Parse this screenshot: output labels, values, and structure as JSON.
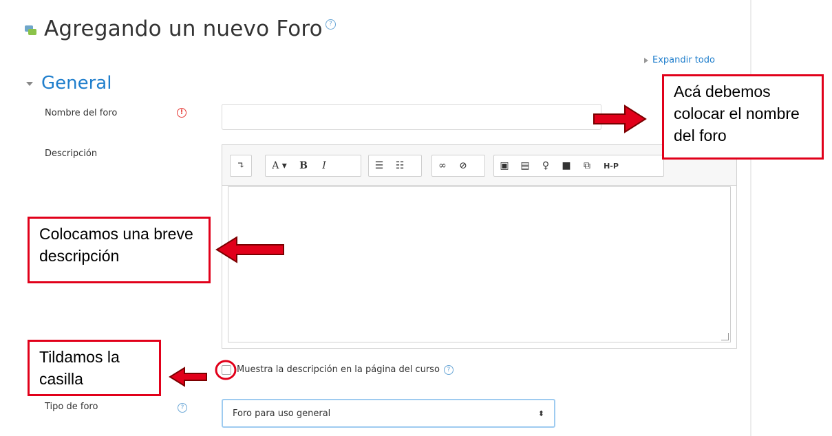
{
  "page": {
    "title": "Agregando un nuevo Foro",
    "expand_all": "Expandir todo"
  },
  "section": {
    "title": "General"
  },
  "form": {
    "name_label": "Nombre del foro",
    "name_value": "",
    "description_label": "Descripción",
    "show_description_label": "Muestra la descripción en la página del curso",
    "forum_type_label": "Tipo de foro",
    "forum_type_value": "Foro para uso general"
  },
  "toolbar": {
    "buttons": [
      "↴",
      "A ▾",
      "B",
      "I",
      "☰",
      "☷",
      "∞",
      "⊘",
      "▣",
      "▤",
      "♀",
      "■",
      "⧉",
      "H-P"
    ]
  },
  "annotations": {
    "name_note": "Acá debemos colocar el nombre del foro",
    "description_note": "Colocamos una breve descripción",
    "checkbox_note": "Tildamos la casilla"
  },
  "colors": {
    "accent": "#1f7ecc",
    "annotation": "#e1001a",
    "required": "#e53935"
  }
}
